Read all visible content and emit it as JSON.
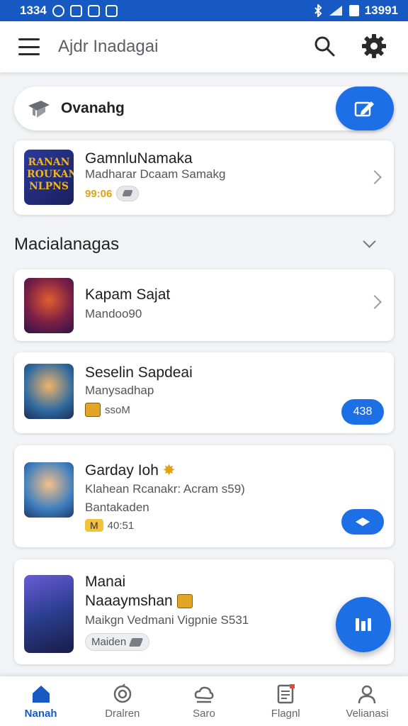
{
  "status_bar": {
    "time_left": "1334",
    "time_right": "13991"
  },
  "app_bar": {
    "title": "Ajdr Inadagai"
  },
  "overview": {
    "label": "Ovanahg"
  },
  "featured": {
    "title": "GamnluNamaka",
    "subtitle": "Madharar Dcaam Samakg",
    "meta": "99:06",
    "thumb_text": "RANAN ROUKAN NLPNS"
  },
  "section": {
    "title": "Macialanagas"
  },
  "items": [
    {
      "title": "Kapam Sajat",
      "subtitle": "Mandoo90"
    },
    {
      "title": "Seselin Sapdeai",
      "subtitle": "Manysadhap",
      "meta": "ssoM",
      "button": "438"
    },
    {
      "title": "Garday Ioh",
      "subtitle": "Klahean Rcanakr: Acram s59)",
      "subtitle2": "Bantakaden",
      "tag": "M",
      "meta": "40:51"
    },
    {
      "title": "Manai",
      "subtitle": "Naaaymshan",
      "subtitle2": "Maikgn Vedmani Vigpnie S531",
      "tag": "Maiden"
    }
  ],
  "bottom_nav": [
    {
      "label": "Nanah",
      "icon": "home-icon",
      "active": true
    },
    {
      "label": "Dralren",
      "icon": "badge-icon",
      "active": false
    },
    {
      "label": "Saro",
      "icon": "cloud-icon",
      "active": false
    },
    {
      "label": "Flagnl",
      "icon": "document-icon",
      "active": false
    },
    {
      "label": "Velianasi",
      "icon": "person-icon",
      "active": false
    }
  ],
  "colors": {
    "primary": "#1d6fe6",
    "status_bar": "#1659c2",
    "background": "#f2f3f6"
  }
}
